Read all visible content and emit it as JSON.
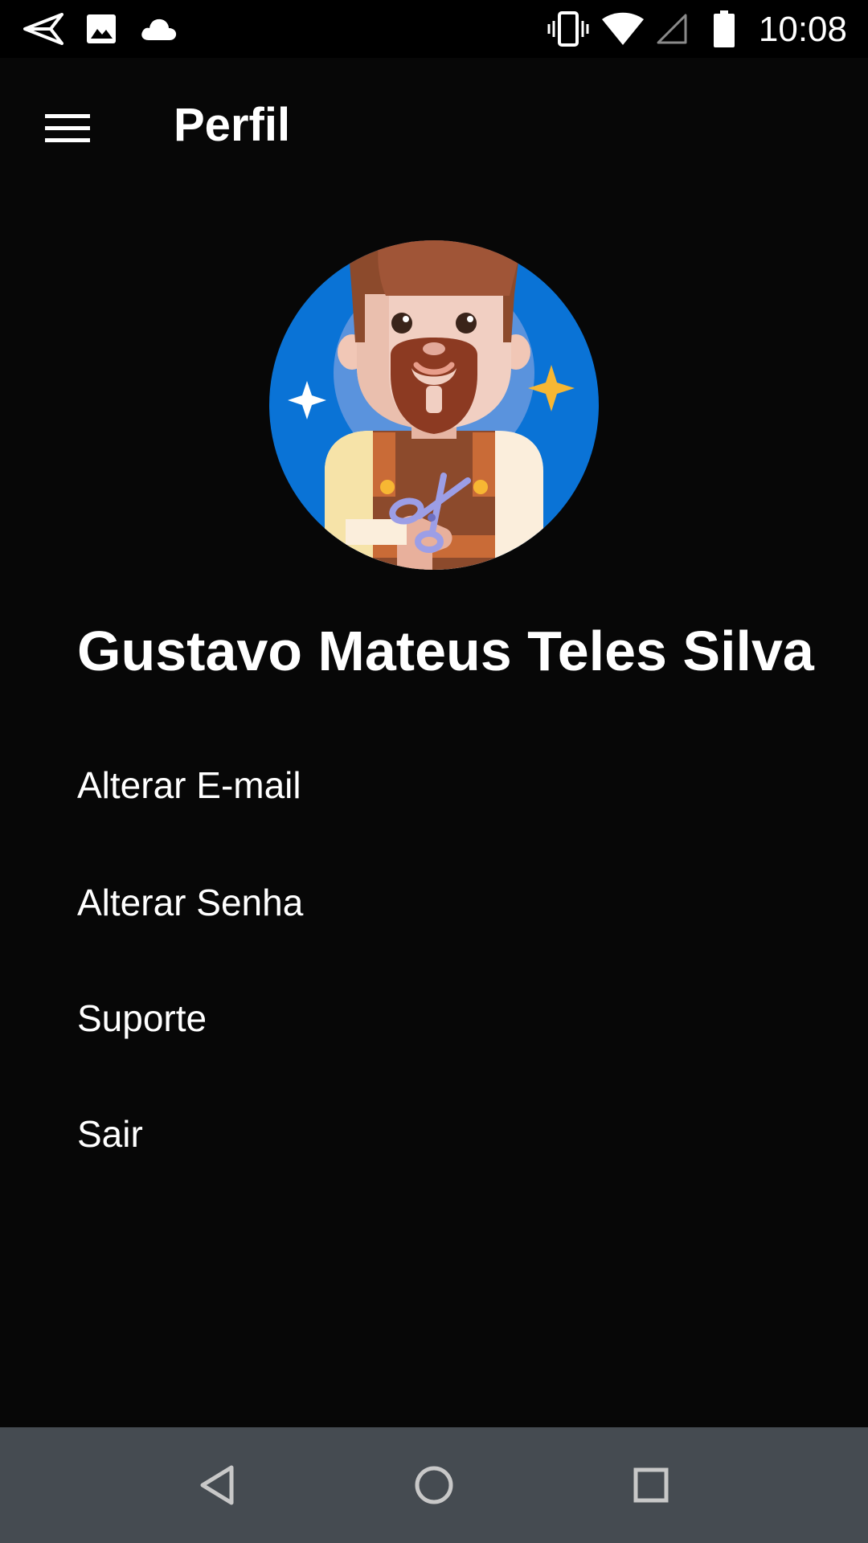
{
  "status_bar": {
    "time": "10:08",
    "left_icons": [
      "send-icon",
      "image-icon",
      "cloud-icon"
    ],
    "right_icons": [
      "vibrate-icon",
      "wifi-icon",
      "cell-signal-icon",
      "battery-icon"
    ]
  },
  "app_bar": {
    "title": "Perfil",
    "menu_icon": "hamburger-menu-icon"
  },
  "profile": {
    "avatar": "barber-avatar",
    "name": "Gustavo Mateus Teles Silva"
  },
  "menu": {
    "items": [
      {
        "label": "Alterar E-mail"
      },
      {
        "label": "Alterar Senha"
      },
      {
        "label": "Suporte"
      },
      {
        "label": "Sair"
      }
    ]
  },
  "nav_bar": {
    "buttons": [
      "back-icon",
      "home-icon",
      "recents-icon"
    ]
  },
  "colors": {
    "background": "#070707",
    "nav_bar": "#454b51",
    "avatar_circle": "#0a73d6",
    "text": "#ffffff"
  }
}
